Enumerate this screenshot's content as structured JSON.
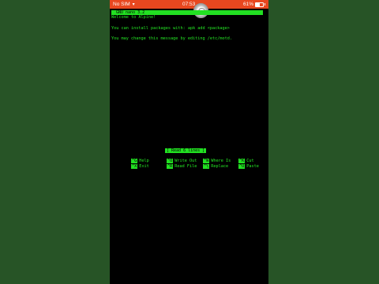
{
  "status_bar": {
    "carrier": "No SIM",
    "time": "07:53",
    "battery": "61%",
    "background_color": "#e8471f"
  },
  "terminal": {
    "title": "GNU nano 3.2",
    "motd_lines": [
      "Welcome to Alpine!",
      "You can install packages with: apk add <package>",
      "You may change this message by editing /etc/motd."
    ],
    "status_message": "[ Read 6 lines ]",
    "text_color": "#24e624",
    "background_color": "#000000"
  },
  "shortcuts": [
    {
      "key": "^G",
      "label": "Help"
    },
    {
      "key": "^O",
      "label": "Write Out"
    },
    {
      "key": "^W",
      "label": "Where Is"
    },
    {
      "key": "^K",
      "label": "Cut"
    },
    {
      "key": "^X",
      "label": "Exit"
    },
    {
      "key": "^R",
      "label": "Read File"
    },
    {
      "key": "^\\",
      "label": "Replace"
    },
    {
      "key": "^U",
      "label": "Paste"
    }
  ],
  "page_background": "#275426"
}
